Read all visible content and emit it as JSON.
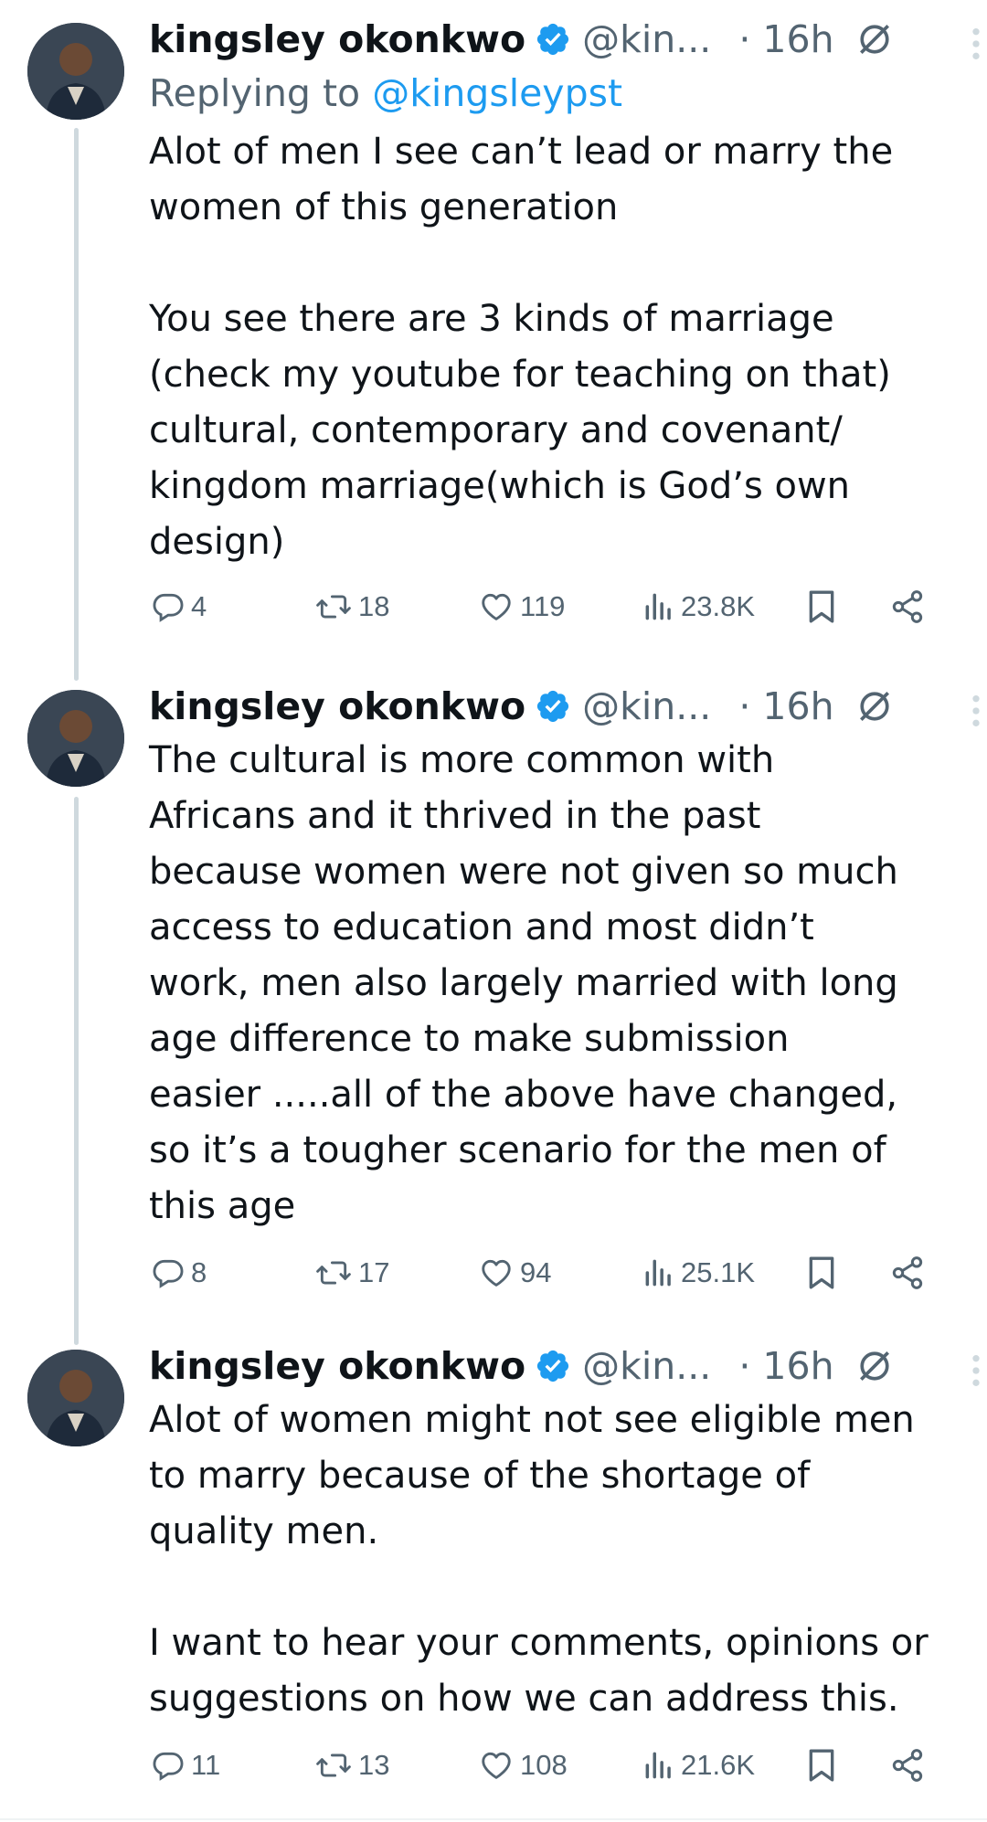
{
  "colors": {
    "accent": "#1d9bf0",
    "secondary_text": "#536471",
    "primary_text": "#0f1419",
    "thread_line": "#cfd9de"
  },
  "tweets": [
    {
      "author_name": "kingsley okonkwo",
      "handle": "@kin...",
      "time": "· 16h",
      "replying_prefix": "Replying to ",
      "replying_mention": "@kingsleypst",
      "text": "Alot of men I see can’t lead or marry the\nwomen of this generation\n\nYou see there are 3 kinds of marriage\n(check my youtube for teaching on that)\ncultural, contemporary and covenant/\nkingdom marriage(which is God’s own\ndesign)",
      "replies": "4",
      "reposts": "18",
      "likes": "119",
      "views": "23.8K"
    },
    {
      "author_name": "kingsley okonkwo",
      "handle": "@kin...",
      "time": "· 16h",
      "text": "The cultural is more common with\nAfricans and it thrived in the past\nbecause women were not given so much\naccess to education and most didn’t\nwork, men also largely married with long\nage difference to make submission\neasier .....all of the above have changed,\nso it’s a tougher scenario for the men of\nthis age",
      "replies": "8",
      "reposts": "17",
      "likes": "94",
      "views": "25.1K"
    },
    {
      "author_name": "kingsley okonkwo",
      "handle": "@kin...",
      "time": "· 16h",
      "text": "Alot of women might not see eligible men\nto marry because of the shortage of\nquality men.\n\nI want to hear your comments, opinions or\nsuggestions on how we can address this.",
      "replies": "11",
      "reposts": "13",
      "likes": "108",
      "views": "21.6K"
    }
  ],
  "icons": {
    "verified": "verified-badge-icon",
    "grok": "grok-icon",
    "more": "more-options-icon",
    "reply": "reply-icon",
    "repost": "repost-icon",
    "like": "like-icon",
    "views": "views-icon",
    "bookmark": "bookmark-icon",
    "share": "share-icon"
  }
}
